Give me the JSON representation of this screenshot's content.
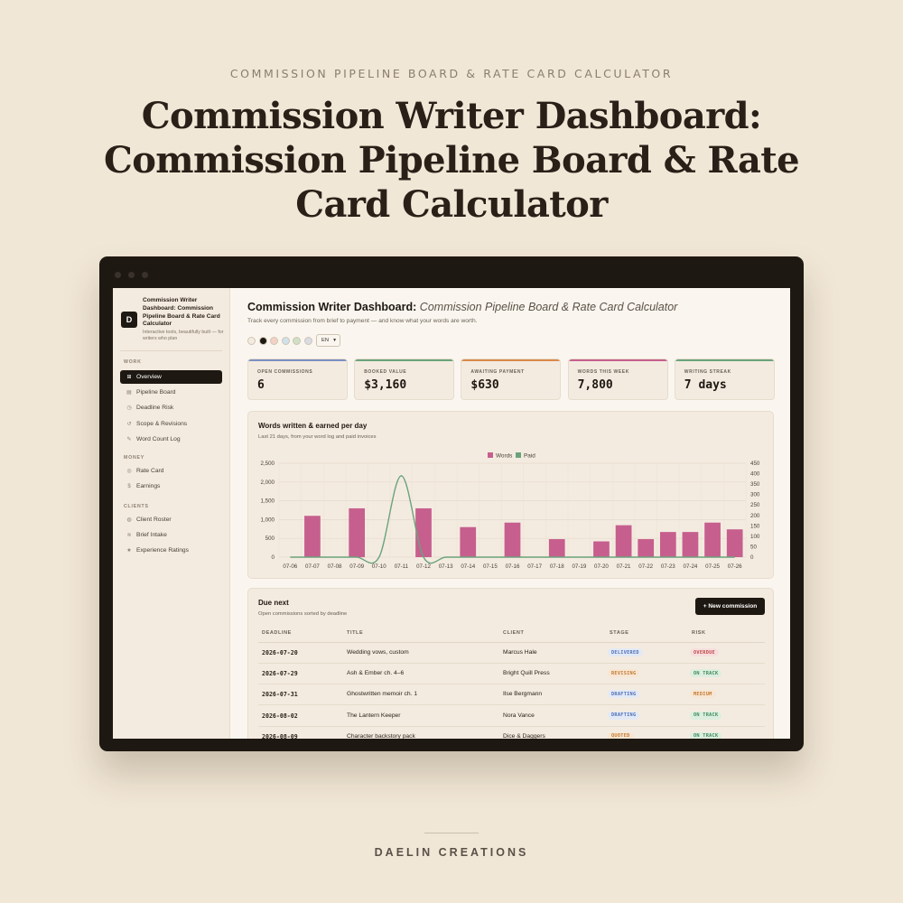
{
  "hero": {
    "eyebrow": "COMMISSION PIPELINE BOARD & RATE CARD CALCULATOR",
    "title": "Commission Writer Dashboard: Commission Pipeline Board & Rate Card Calculator"
  },
  "footer": {
    "brand": "DAELIN CREATIONS"
  },
  "sidebar": {
    "logo_letter": "D",
    "brand_title": "Commission Writer Dashboard: Commission Pipeline Board & Rate Card Calculator",
    "brand_sub": "Interactive tools, beautifully built — for writers who plan",
    "sections": [
      {
        "label": "WORK",
        "items": [
          {
            "label": "Overview",
            "icon": "grid-icon",
            "glyph": "⊞",
            "active": true
          },
          {
            "label": "Pipeline Board",
            "icon": "board-icon",
            "glyph": "▤",
            "active": false
          },
          {
            "label": "Deadline Risk",
            "icon": "clock-icon",
            "glyph": "◷",
            "active": false
          },
          {
            "label": "Scope & Revisions",
            "icon": "revision-icon",
            "glyph": "↺",
            "active": false
          },
          {
            "label": "Word Count Log",
            "icon": "pen-icon",
            "glyph": "✎",
            "active": false
          }
        ]
      },
      {
        "label": "MONEY",
        "items": [
          {
            "label": "Rate Card",
            "icon": "rate-icon",
            "glyph": "◎",
            "active": false
          },
          {
            "label": "Earnings",
            "icon": "dollar-icon",
            "glyph": "$",
            "active": false
          }
        ]
      },
      {
        "label": "CLIENTS",
        "items": [
          {
            "label": "Client Roster",
            "icon": "roster-icon",
            "glyph": "◍",
            "active": false
          },
          {
            "label": "Brief Intake",
            "icon": "intake-icon",
            "glyph": "≋",
            "active": false
          },
          {
            "label": "Experience Ratings",
            "icon": "star-icon",
            "glyph": "★",
            "active": false
          }
        ]
      }
    ]
  },
  "header": {
    "title_bold": "Commission Writer Dashboard:",
    "title_italic": "Commission Pipeline Board & Rate Card Calculator",
    "subtitle": "Track every commission from brief to payment — and know what your words are worth.",
    "theme_swatches": [
      "#f4ebe0",
      "#1e1812",
      "#f3d2c6",
      "#cfe2ea",
      "#cfe1c4",
      "#d9dbe6"
    ],
    "language": "EN"
  },
  "kpis": [
    {
      "label": "OPEN COMMISSIONS",
      "value": "6",
      "color": "#7b8fc4"
    },
    {
      "label": "BOOKED VALUE",
      "value": "$3,160",
      "color": "#6aa37b"
    },
    {
      "label": "AWAITING PAYMENT",
      "value": "$630",
      "color": "#d98a4a"
    },
    {
      "label": "WORDS THIS WEEK",
      "value": "7,800",
      "color": "#c65f8e"
    },
    {
      "label": "WRITING STREAK",
      "value": "7 days",
      "color": "#6aa37b"
    }
  ],
  "chart_card": {
    "title": "Words written & earned per day",
    "subtitle": "Last 21 days, from your word log and paid invoices"
  },
  "chart_data": {
    "type": "bar",
    "title": "Words written & earned per day",
    "categories": [
      "07-06",
      "07-07",
      "07-08",
      "07-09",
      "07-10",
      "07-11",
      "07-12",
      "07-13",
      "07-14",
      "07-15",
      "07-16",
      "07-17",
      "07-18",
      "07-19",
      "07-20",
      "07-21",
      "07-22",
      "07-23",
      "07-24",
      "07-25",
      "07-26"
    ],
    "series": [
      {
        "name": "Words",
        "kind": "bar",
        "axis": "left",
        "color": "#c65f8e",
        "values": [
          0,
          1100,
          0,
          1300,
          0,
          0,
          1300,
          0,
          800,
          0,
          920,
          0,
          480,
          0,
          420,
          850,
          480,
          670,
          670,
          920,
          740
        ]
      },
      {
        "name": "Paid",
        "kind": "line",
        "axis": "right",
        "color": "#6aa37b",
        "values": [
          0,
          0,
          0,
          0,
          0,
          390,
          0,
          0,
          0,
          0,
          0,
          0,
          0,
          0,
          0,
          0,
          0,
          0,
          0,
          0,
          0
        ]
      }
    ],
    "y_left": {
      "min": 0,
      "max": 2500,
      "ticks": [
        0,
        500,
        1000,
        1500,
        2000,
        2500
      ],
      "tick_labels": [
        "0",
        "500",
        "1,000",
        "1,500",
        "2,000",
        "2,500"
      ]
    },
    "y_right": {
      "min": 0,
      "max": 450,
      "ticks": [
        0,
        50,
        100,
        150,
        200,
        250,
        300,
        350,
        400,
        450
      ],
      "tick_labels": [
        "0",
        "50",
        "100",
        "150",
        "200",
        "250",
        "300",
        "350",
        "400",
        "450"
      ]
    },
    "legend": "top-center",
    "grid": true
  },
  "due_card": {
    "title": "Due next",
    "subtitle": "Open commissions sorted by deadline",
    "new_button": "+ New commission",
    "headers": [
      "DEADLINE",
      "TITLE",
      "CLIENT",
      "STAGE",
      "RISK"
    ],
    "rows": [
      {
        "deadline": "2026-07-20",
        "title": "Wedding vows, custom",
        "client": "Marcus Hale",
        "stage": "DELIVERED",
        "risk": "OVERDUE"
      },
      {
        "deadline": "2026-07-29",
        "title": "Ash & Ember ch. 4–6",
        "client": "Bright Quill Press",
        "stage": "REVISING",
        "risk": "ON TRACK"
      },
      {
        "deadline": "2026-07-31",
        "title": "Ghostwritten memoir ch. 1",
        "client": "Ilse Bergmann",
        "stage": "DRAFTING",
        "risk": "MEDIUM"
      },
      {
        "deadline": "2026-08-02",
        "title": "The Lantern Keeper",
        "client": "Nora Vance",
        "stage": "DRAFTING",
        "risk": "ON TRACK"
      },
      {
        "deadline": "2026-08-09",
        "title": "Character backstory pack",
        "client": "Dice & Daggers",
        "stage": "QUOTED",
        "risk": "ON TRACK"
      }
    ],
    "badge_colors": {
      "DELIVERED": {
        "fg": "#4f6fb8",
        "bg": "#e3e9f5"
      },
      "REVISING": {
        "fg": "#c6782e",
        "bg": "#f7e6d3"
      },
      "DRAFTING": {
        "fg": "#4f6fb8",
        "bg": "#e3e9f5"
      },
      "QUOTED": {
        "fg": "#c6782e",
        "bg": "#f7e6d3"
      },
      "OVERDUE": {
        "fg": "#c24848",
        "bg": "#f6dede"
      },
      "ON TRACK": {
        "fg": "#3f8a5a",
        "bg": "#dceedf"
      },
      "MEDIUM": {
        "fg": "#c6782e",
        "bg": "#f7e6d3"
      }
    }
  }
}
